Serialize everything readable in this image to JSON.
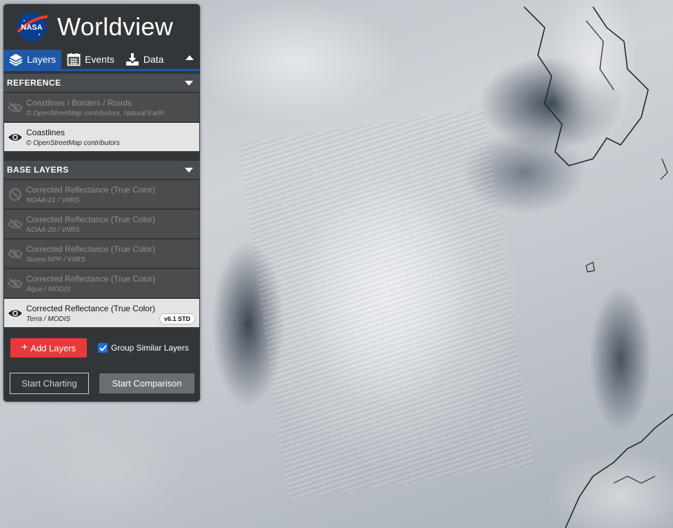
{
  "app": {
    "title": "Worldview",
    "logo_text": "NASA"
  },
  "tabs": [
    {
      "label": "Layers",
      "icon": "layers-icon",
      "active": true
    },
    {
      "label": "Events",
      "icon": "calendar-icon",
      "active": false
    },
    {
      "label": "Data",
      "icon": "download-icon",
      "active": false
    }
  ],
  "sections": {
    "reference": {
      "title": "REFERENCE",
      "layers": [
        {
          "name": "Coastlines / Borders / Roads",
          "source": "© OpenStreetMap contributors, Natural Earth",
          "state": "hidden"
        },
        {
          "name": "Coastlines",
          "source": "© OpenStreetMap contributors",
          "state": "visible"
        }
      ]
    },
    "base": {
      "title": "BASE LAYERS",
      "layers": [
        {
          "name": "Corrected Reflectance (True Color)",
          "source": "NOAA-21 / VIIRS",
          "state": "unavailable"
        },
        {
          "name": "Corrected Reflectance (True Color)",
          "source": "NOAA-20 / VIIRS",
          "state": "hidden"
        },
        {
          "name": "Corrected Reflectance (True Color)",
          "source": "Suomi NPP / VIIRS",
          "state": "hidden"
        },
        {
          "name": "Corrected Reflectance (True Color)",
          "source": "Aqua / MODIS",
          "state": "hidden"
        },
        {
          "name": "Corrected Reflectance (True Color)",
          "source": "Terra / MODIS",
          "state": "visible",
          "badge": "v6.1 STD"
        }
      ]
    }
  },
  "actions": {
    "add_layers": "Add Layers",
    "group_similar": "Group Similar Layers",
    "group_checked": true,
    "start_charting": "Start Charting",
    "start_comparison": "Start Comparison"
  },
  "colors": {
    "accent": "#1e58a8",
    "add_button": "#e83a3a",
    "panel": "#333638"
  }
}
